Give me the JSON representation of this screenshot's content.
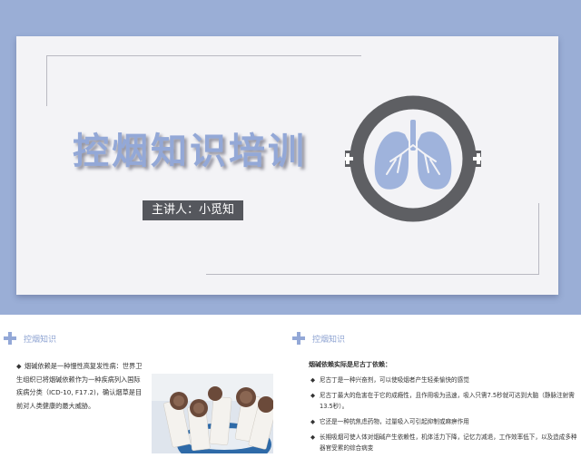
{
  "title_slide": {
    "title": "控烟知识培训",
    "presenter_label": "主讲人：小觅知",
    "colors": {
      "accent": "#93a8d7",
      "frame": "#9aaed6",
      "ring": "#5e5f63",
      "lung": "#9fb3dc"
    }
  },
  "left_slide": {
    "section_title": "控烟知识",
    "bullet_marker": "◆",
    "paragraph": "烟碱依赖是一种慢性高复发性病：世界卫生组织已将烟碱依赖作为一种疾病列入国际疾病分类（ICD-10, F17.2)，确认烟草是目前对人类健康的最大威胁。",
    "photo_icon": "cigarettes-photo"
  },
  "right_slide": {
    "section_title": "控烟知识",
    "heading": "烟碱依赖实际是尼古丁依赖：",
    "bullet_marker": "◆",
    "bullets": [
      "尼古丁是一种兴奋剂，可以使吸烟者产生轻柔愉快的感觉",
      "尼古丁最大的危害在于它的成瘾性，且作用吸为迅速，吸入只需7.5秒就可达到大脑（静脉注射需13.5秒）。",
      "它还是一种抗焦虑药物，过量吸入可引起抑制或麻痹作用",
      "长期吸烟可使人体对烟碱产生依赖性，机体活力下降，记忆力减退，工作效率低下，以及造成多种器官受累的综合病变"
    ]
  }
}
